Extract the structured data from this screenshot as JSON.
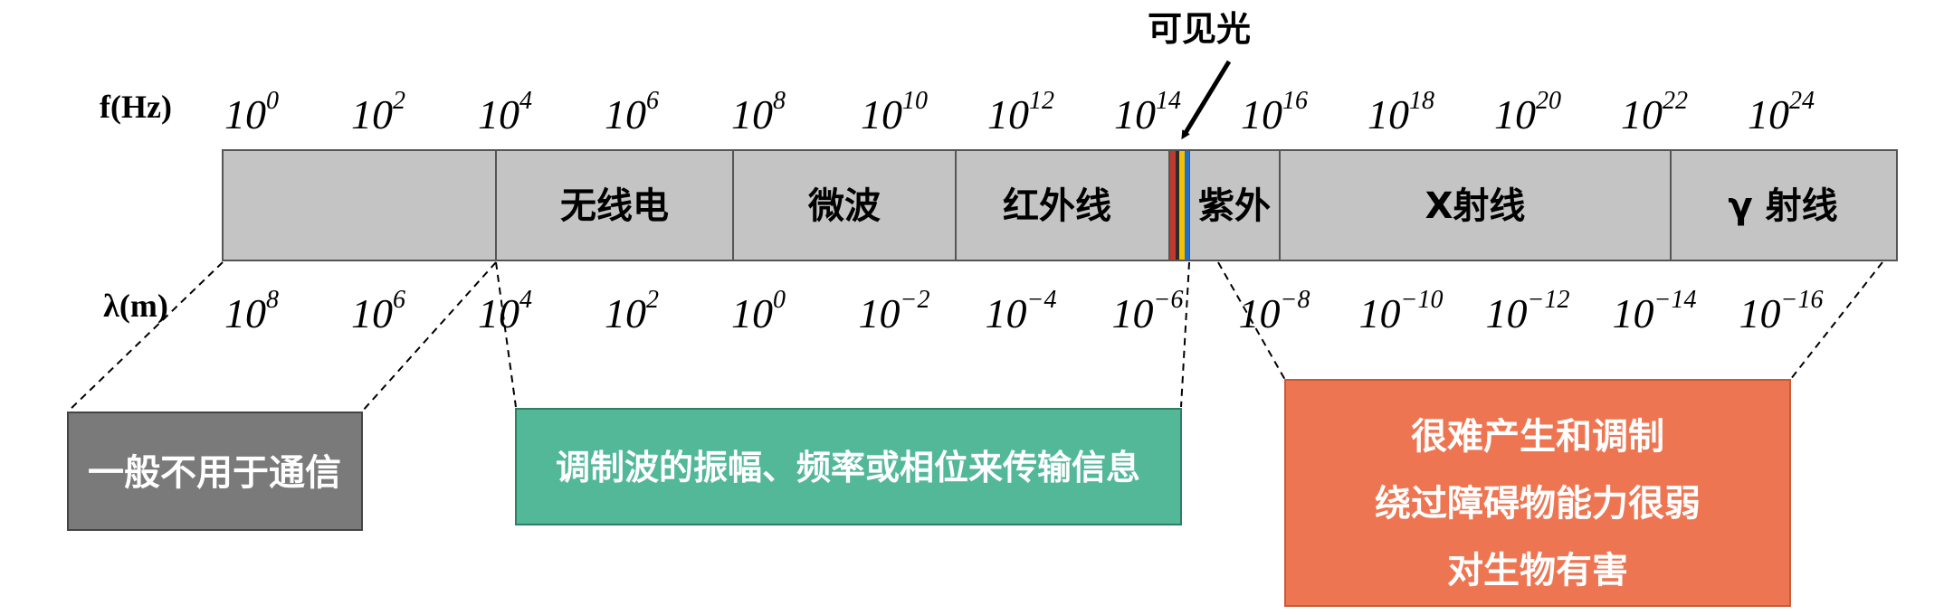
{
  "visible_light_label": "可见光",
  "frequency_axis": {
    "label": "f(Hz)",
    "ticks": [
      {
        "base": "10",
        "exp": "0"
      },
      {
        "base": "10",
        "exp": "2"
      },
      {
        "base": "10",
        "exp": "4"
      },
      {
        "base": "10",
        "exp": "6"
      },
      {
        "base": "10",
        "exp": "8"
      },
      {
        "base": "10",
        "exp": "10"
      },
      {
        "base": "10",
        "exp": "12"
      },
      {
        "base": "10",
        "exp": "14"
      },
      {
        "base": "10",
        "exp": "16"
      },
      {
        "base": "10",
        "exp": "18"
      },
      {
        "base": "10",
        "exp": "20"
      },
      {
        "base": "10",
        "exp": "22"
      },
      {
        "base": "10",
        "exp": "24"
      }
    ]
  },
  "wavelength_axis": {
    "label": "λ(m)",
    "ticks": [
      {
        "base": "10",
        "exp": "8"
      },
      {
        "base": "10",
        "exp": "6"
      },
      {
        "base": "10",
        "exp": "4"
      },
      {
        "base": "10",
        "exp": "2"
      },
      {
        "base": "10",
        "exp": "0"
      },
      {
        "base": "10",
        "exp": "−2"
      },
      {
        "base": "10",
        "exp": "−4"
      },
      {
        "base": "10",
        "exp": "−6"
      },
      {
        "base": "10",
        "exp": "−8"
      },
      {
        "base": "10",
        "exp": "−10"
      },
      {
        "base": "10",
        "exp": "−12"
      },
      {
        "base": "10",
        "exp": "−14"
      },
      {
        "base": "10",
        "exp": "−16"
      }
    ]
  },
  "bands": [
    {
      "id": "unlabeled",
      "label": ""
    },
    {
      "id": "radio",
      "label": "无线电"
    },
    {
      "id": "microwave",
      "label": "微波"
    },
    {
      "id": "infrared",
      "label": "红外线"
    },
    {
      "id": "ultraviolet",
      "label": "紫外"
    },
    {
      "id": "xray",
      "label": "X射线"
    },
    {
      "id": "gamma",
      "label": "γ 射线"
    }
  ],
  "visible_stripe_colors": [
    "#c0392b",
    "#2c2c2c",
    "#f2c200",
    "#1f6fd1"
  ],
  "notes": {
    "gray": {
      "lines": [
        "一般不用于通信"
      ],
      "color": "#7a7a7a"
    },
    "green": {
      "lines": [
        "调制波的振幅、频率或相位来传输信息"
      ],
      "color": "#52b898"
    },
    "orange": {
      "lines": [
        "很难产生和调制",
        "绕过障碍物能力很弱",
        "对生物有害"
      ],
      "color": "#ee7552"
    }
  },
  "band_fill_color": "#c4c4c4"
}
